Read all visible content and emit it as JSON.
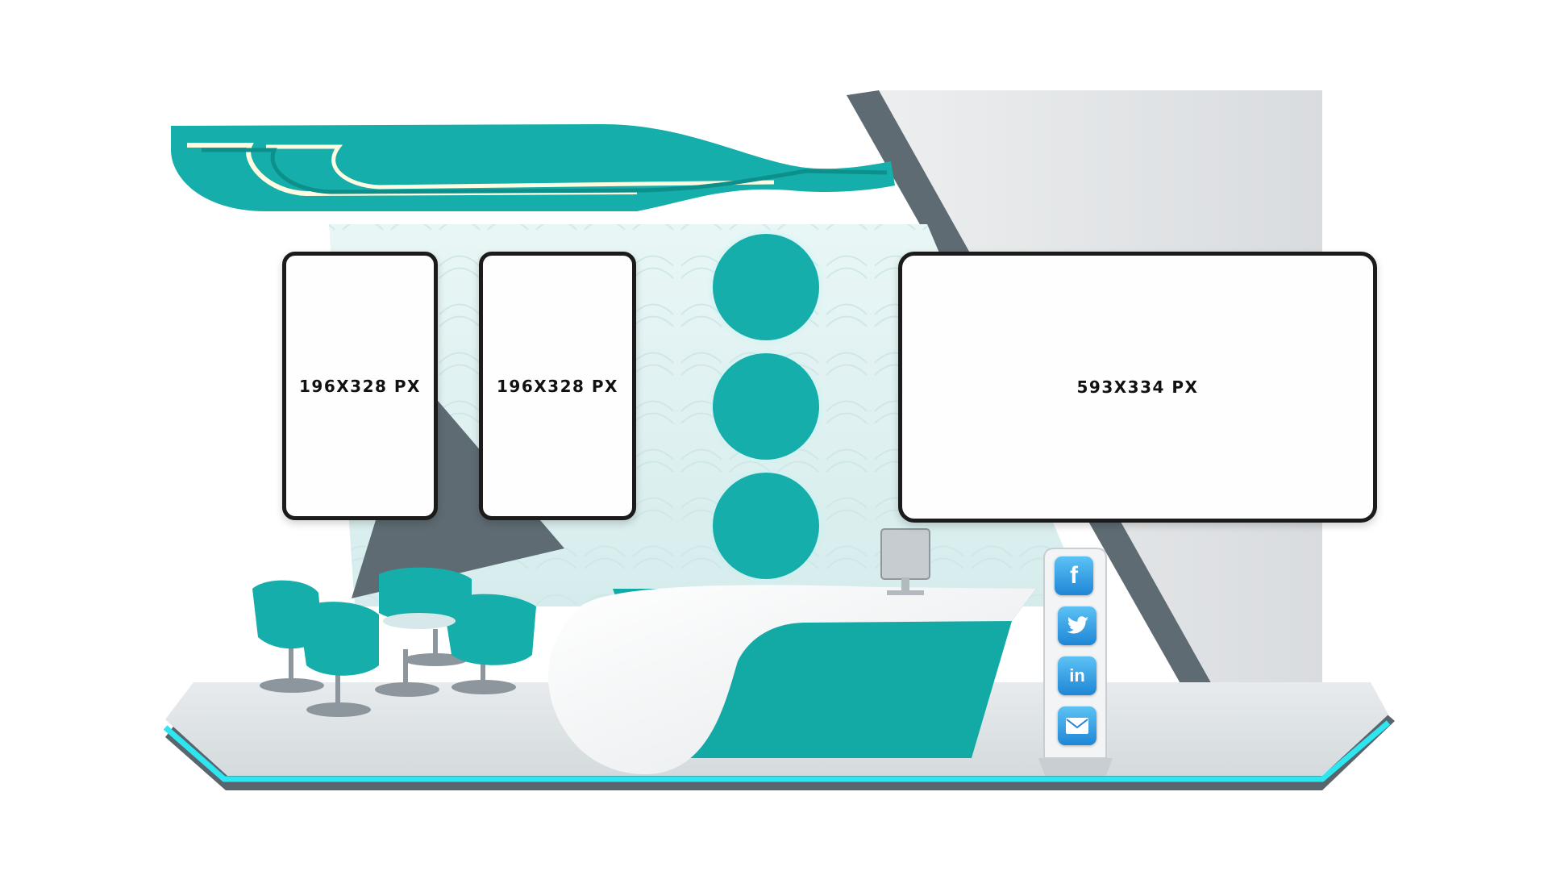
{
  "screens": [
    {
      "label": "196X328 PX"
    },
    {
      "label": "196X328 PX"
    },
    {
      "label": "593X334 PX"
    }
  ],
  "kiosk": {
    "icons": [
      "facebook-icon",
      "twitter-icon",
      "linkedin-icon",
      "mail-icon"
    ]
  },
  "colors": {
    "teal": "#15aeaa",
    "floor": "#dfe4e6",
    "floor_glow": "#2ee6f0",
    "panel_gray": "#5f6b73",
    "wall_light": "#e3e5e7"
  }
}
